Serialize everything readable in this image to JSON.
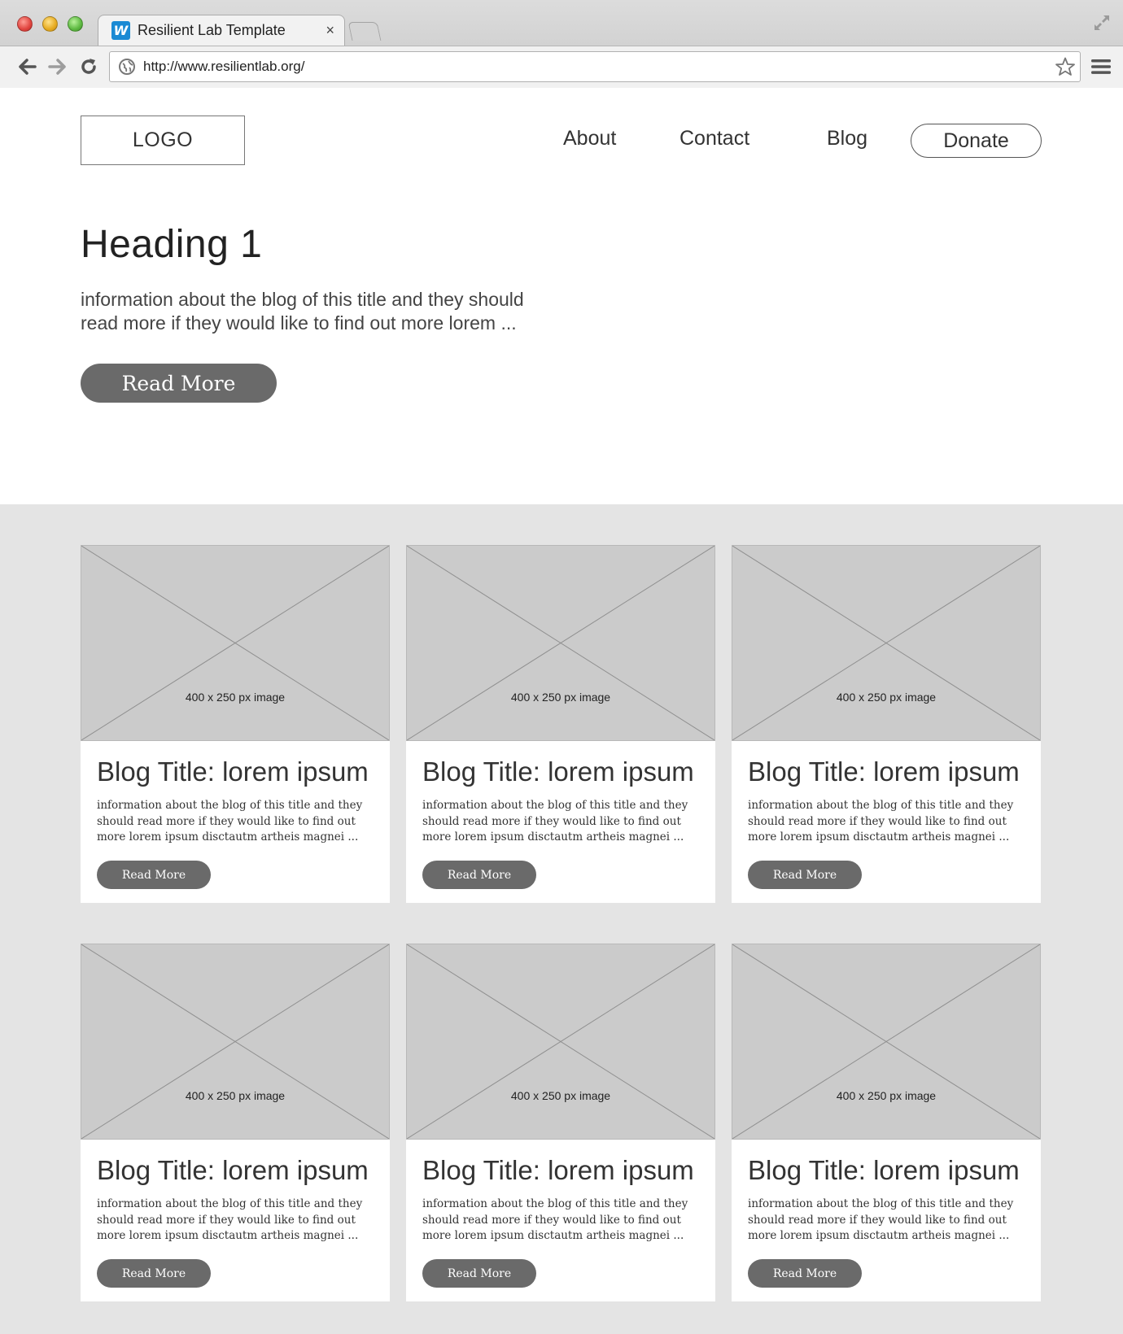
{
  "browser": {
    "tab_title": "Resilient Lab Template",
    "tab_close": "×",
    "favicon_letter": "W",
    "url": "http://www.resilientlab.org/"
  },
  "site": {
    "logo": "LOGO",
    "nav": {
      "about": "About",
      "contact": "Contact",
      "blog": "Blog",
      "donate": "Donate"
    }
  },
  "hero": {
    "heading": "Heading 1",
    "text": "information about the blog of this title and they should read more if they would like to find out more lorem ...",
    "button": "Read More"
  },
  "cards": [
    {
      "image_label": "400 x 250 px image",
      "title": "Blog Title: lorem ipsum",
      "text": "information about the blog of this title and they should read more if they would like to find out more lorem ipsum disctautm artheis magnei ...",
      "button": "Read More"
    },
    {
      "image_label": "400 x 250 px image",
      "title": "Blog Title: lorem ipsum",
      "text": "information about the blog of this title and they should read more if they would like to find out more lorem ipsum disctautm artheis magnei ...",
      "button": "Read More"
    },
    {
      "image_label": "400 x 250 px image",
      "title": "Blog Title: lorem ipsum",
      "text": "information about the blog of this title and they should read more if they would like to find out more lorem ipsum disctautm artheis magnei ...",
      "button": "Read More"
    },
    {
      "image_label": "400 x 250 px image",
      "title": "Blog Title: lorem ipsum",
      "text": "information about the blog of this title and they should read more if they would like to find out more lorem ipsum disctautm artheis magnei ...",
      "button": "Read More"
    },
    {
      "image_label": "400 x 250 px image",
      "title": "Blog Title: lorem ipsum",
      "text": "information about the blog of this title and they should read more if they would like to find out more lorem ipsum disctautm artheis magnei ...",
      "button": "Read More"
    },
    {
      "image_label": "400 x 250 px image",
      "title": "Blog Title: lorem ipsum",
      "text": "information about the blog of this title and they should read more if they would like to find out more lorem ipsum disctautm artheis magnei ...",
      "button": "Read More"
    }
  ],
  "colors": {
    "button_fill": "#6a6a6a",
    "section_bg": "#e4e4e4",
    "placeholder_bg": "#cbcbcb",
    "favicon": "#1a8ad4"
  }
}
